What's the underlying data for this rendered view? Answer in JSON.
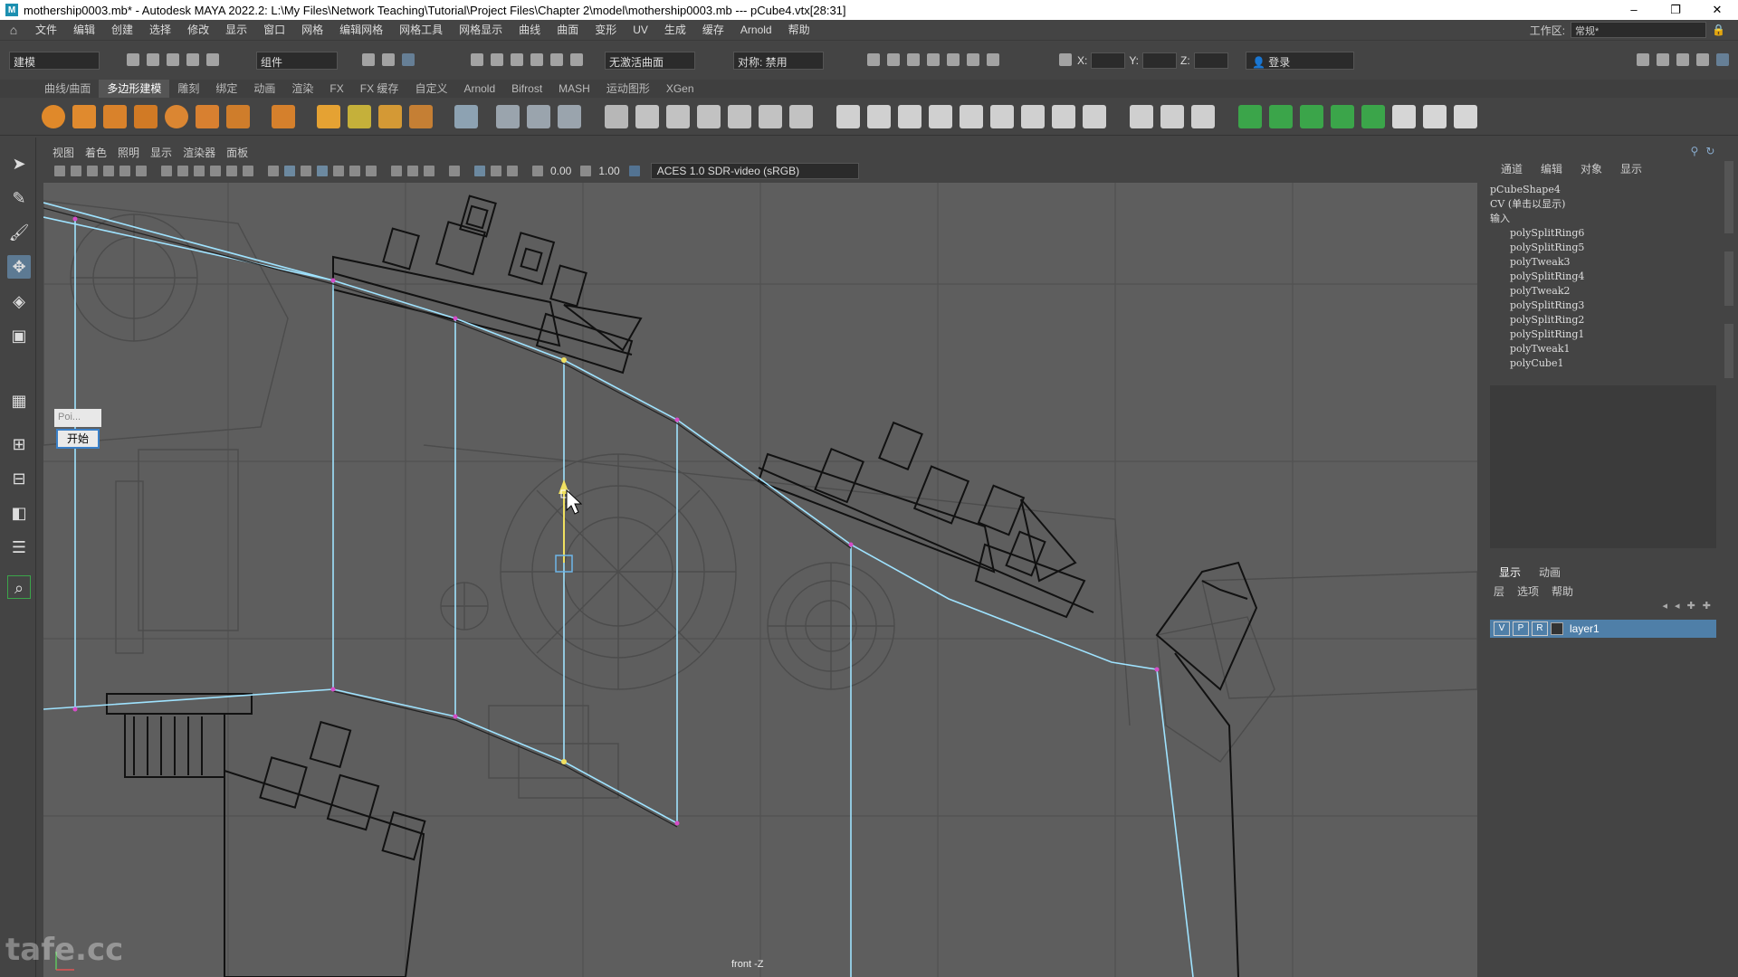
{
  "window": {
    "title": "mothership0003.mb* - Autodesk MAYA 2022.2: L:\\My Files\\Network Teaching\\Tutorial\\Project Files\\Chapter 2\\model\\mothership0003.mb  ---  pCube4.vtx[28:31]",
    "minimize": "–",
    "restore": "❐",
    "close": "✕"
  },
  "menubar": {
    "items": [
      "文件",
      "编辑",
      "创建",
      "选择",
      "修改",
      "显示",
      "窗口",
      "网格",
      "编辑网格",
      "网格工具",
      "网格显示",
      "曲线",
      "曲面",
      "变形",
      "UV",
      "生成",
      "缓存",
      "Arnold",
      "帮助"
    ],
    "workspace_label": "工作区:",
    "workspace_value": "常规*"
  },
  "statusline": {
    "mode": "建模",
    "component": "组件",
    "live": "无激活曲面",
    "symmetry": "对称: 禁用",
    "x_label": "X:",
    "y_label": "Y:",
    "z_label": "Z:",
    "login": "登录"
  },
  "shelf": {
    "tabs": [
      "曲线/曲面",
      "多边形建模",
      "雕刻",
      "绑定",
      "动画",
      "渲染",
      "FX",
      "FX 缓存",
      "自定义",
      "Arnold",
      "Bifrost",
      "MASH",
      "运动图形",
      "XGen"
    ],
    "active_tab": "多边形建模"
  },
  "viewport": {
    "menu": [
      "视图",
      "着色",
      "照明",
      "显示",
      "渲染器",
      "面板"
    ],
    "exposure": "0.00",
    "gamma": "1.00",
    "colorspace": "ACES 1.0 SDR-video (sRGB)",
    "view_label": "front -Z"
  },
  "prompt": {
    "input_value": "Poi...",
    "button_label": "开始"
  },
  "channel_box": {
    "tabs": [
      "通道",
      "编辑",
      "对象",
      "显示"
    ],
    "shape": "pCubeShape4",
    "cv_line": "CV (单击以显示)",
    "inputs_label": "输入",
    "inputs": [
      "polySplitRing6",
      "polySplitRing5",
      "polyTweak3",
      "polySplitRing4",
      "polyTweak2",
      "polySplitRing3",
      "polySplitRing2",
      "polySplitRing1",
      "polyTweak1",
      "polyCube1"
    ]
  },
  "layer_editor": {
    "tabs": [
      "显示",
      "动画"
    ],
    "active_tab": "显示",
    "menu": [
      "层",
      "选项",
      "帮助"
    ],
    "layer": {
      "v": "V",
      "p": "P",
      "r": "R",
      "name": "layer1"
    }
  },
  "watermark": "tafe.cc",
  "colors": {
    "accent": "#5285a6",
    "wire_blue": "#9fe3ff",
    "viewport_bg": "#5e5e5e",
    "layer_row": "#4f7fa8"
  }
}
